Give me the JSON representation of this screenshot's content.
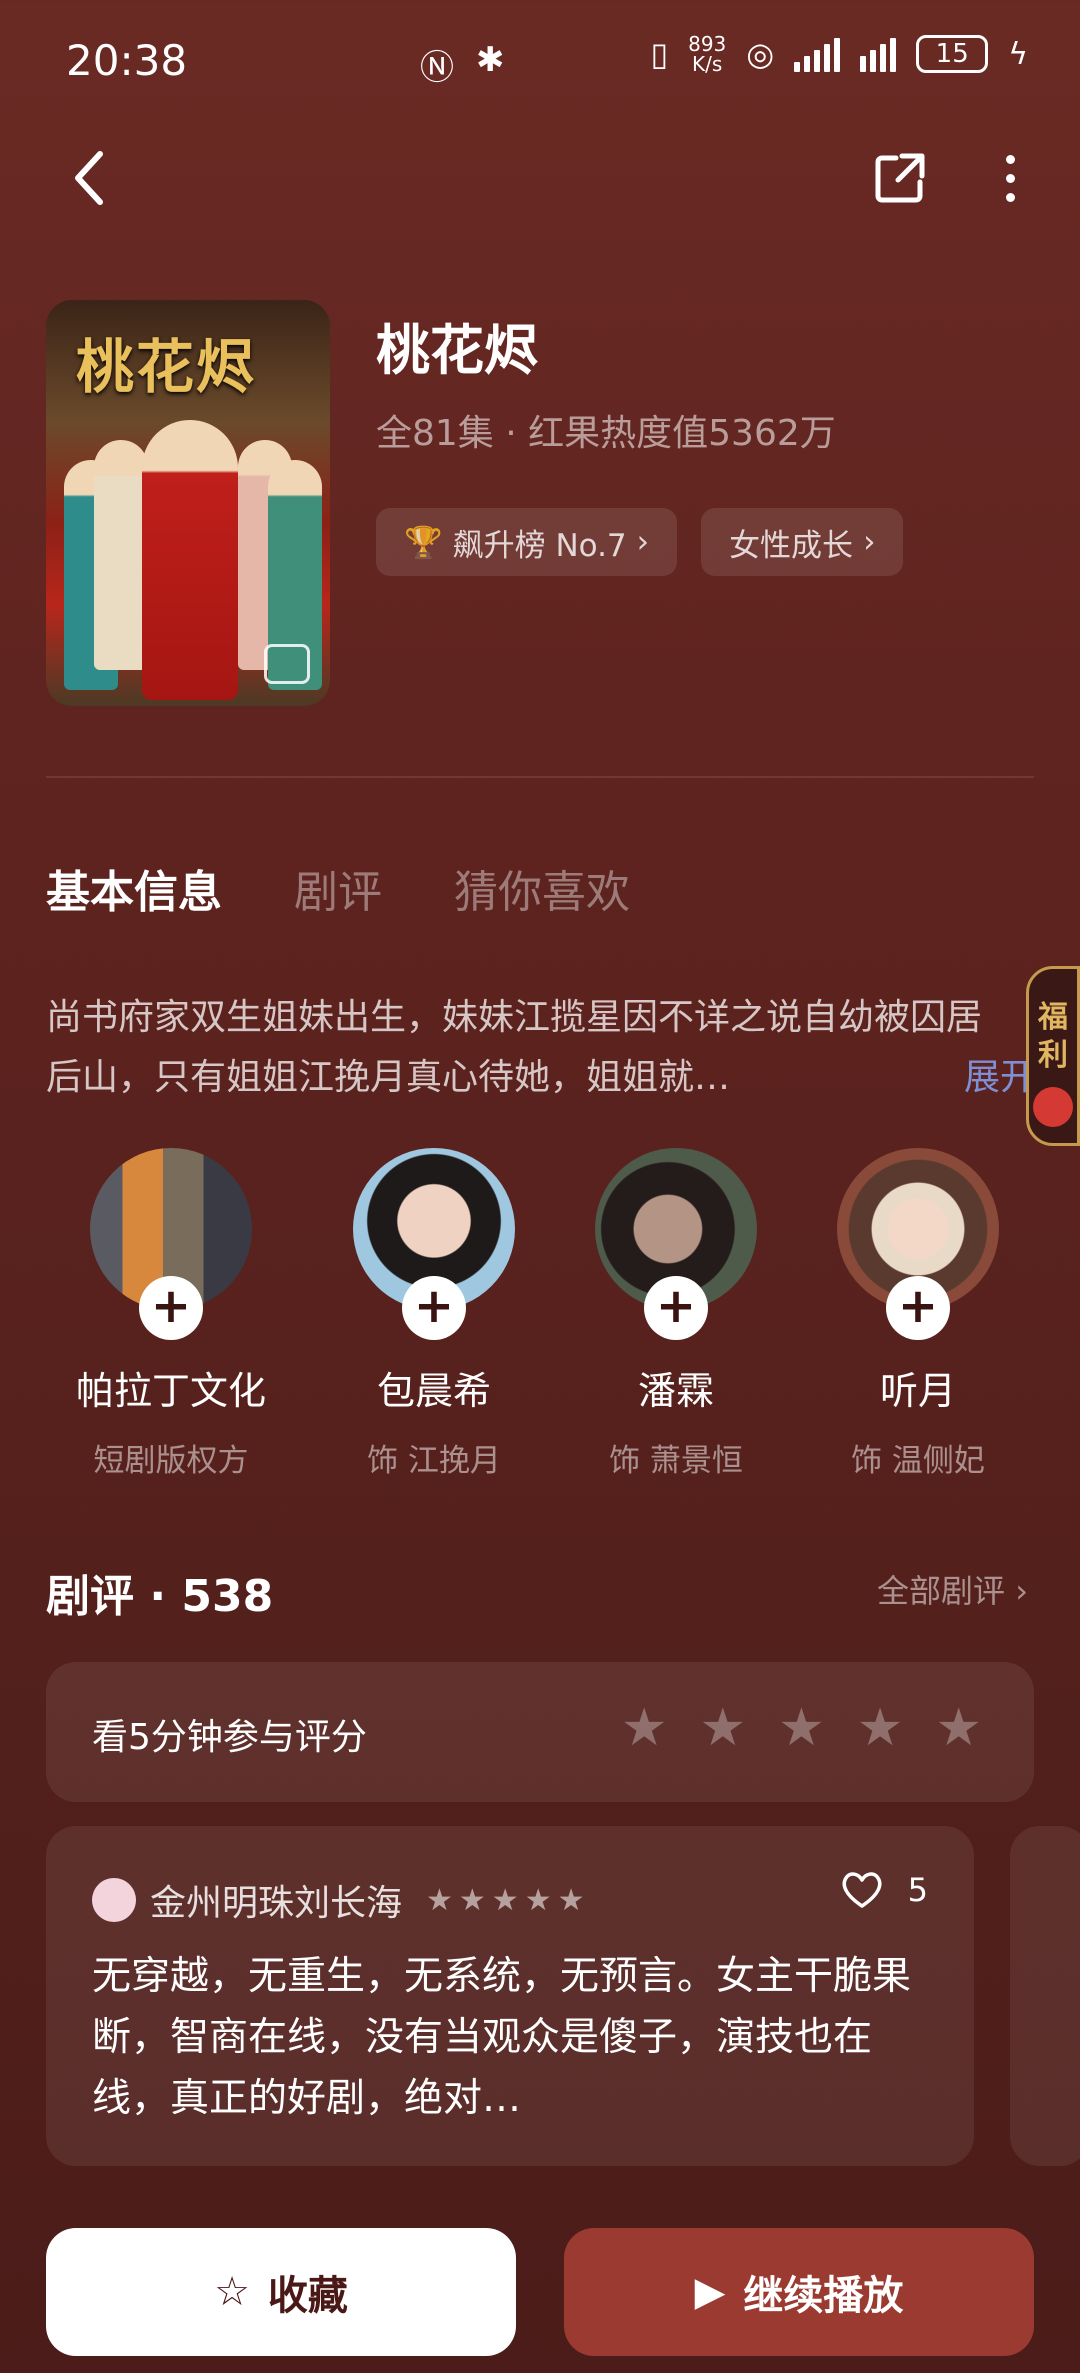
{
  "status": {
    "time": "20:38",
    "net_speed_value": "893",
    "net_speed_unit": "K/s",
    "battery": "15"
  },
  "drama": {
    "poster_title": "桃花烬",
    "title": "桃花烬",
    "meta": "全81集 · 红果热度值5362万",
    "tags": [
      "飙升榜 No.7",
      "女性成长"
    ]
  },
  "tabs": [
    "基本信息",
    "剧评",
    "猜你喜欢"
  ],
  "description": {
    "text": "尚书府家双生姐妹出生，妹妹江揽星因不详之说自幼被囚居后山，只有姐姐江挽月真心待她，姐姐就…",
    "expand": "展开"
  },
  "welfare": [
    "福",
    "利"
  ],
  "cast": [
    {
      "name": "帕拉丁文化",
      "role": "短剧版权方"
    },
    {
      "name": "包晨希",
      "role": "饰 江挽月"
    },
    {
      "name": "潘霖",
      "role": "饰 萧景恒"
    },
    {
      "name": "听月",
      "role": "饰 温侧妃"
    }
  ],
  "reviews": {
    "header": "剧评 · 538",
    "all_link": "全部剧评",
    "rate_prompt": "看5分钟参与评分",
    "card": {
      "user": "金州明珠刘长海",
      "stars": "★★★★★",
      "likes": "5",
      "text": "无穿越，无重生，无系统，无预言。女主干脆果断，智商在线，没有当观众是傻子，演技也在线，真正的好剧，绝对…"
    }
  },
  "buttons": {
    "favorite": "收藏",
    "continue": "继续播放"
  },
  "colors": {
    "background": "#5e231f",
    "play_button": "#9b3a31",
    "expand_link": "#7e8fd6"
  }
}
